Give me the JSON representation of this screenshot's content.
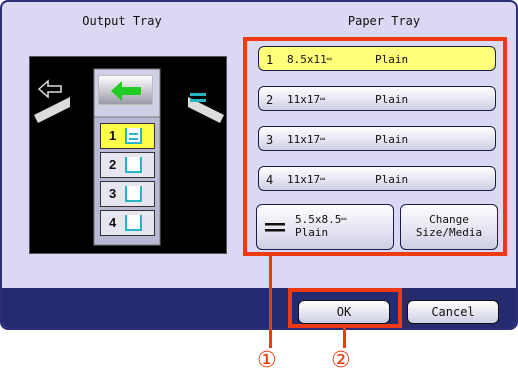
{
  "headers": {
    "output_tray": "Output Tray",
    "paper_tray": "Paper Tray"
  },
  "output_bins": [
    {
      "number": "1",
      "selected": true
    },
    {
      "number": "2",
      "selected": false
    },
    {
      "number": "3",
      "selected": false
    },
    {
      "number": "4",
      "selected": false
    }
  ],
  "paper_trays": [
    {
      "number": "1",
      "size": "8.5x11",
      "media": "Plain",
      "selected": true
    },
    {
      "number": "2",
      "size": "11x17",
      "media": "Plain",
      "selected": false
    },
    {
      "number": "3",
      "size": "11x17",
      "media": "Plain",
      "selected": false
    },
    {
      "number": "4",
      "size": "11x17",
      "media": "Plain",
      "selected": false
    }
  ],
  "orientation_glyph": "▭",
  "bypass": {
    "size": "5.5x8.5",
    "media": "Plain"
  },
  "change_button": {
    "line1": "Change",
    "line2": "Size/Media"
  },
  "ok_label": "OK",
  "cancel_label": "Cancel",
  "callouts": {
    "one": "①",
    "two": "②"
  },
  "colors": {
    "highlight": "#ee3a12",
    "selected": "#ffff4a",
    "footer": "#262a6e",
    "bin_icon": "#27b4c4",
    "arrow": "#22cc22"
  }
}
